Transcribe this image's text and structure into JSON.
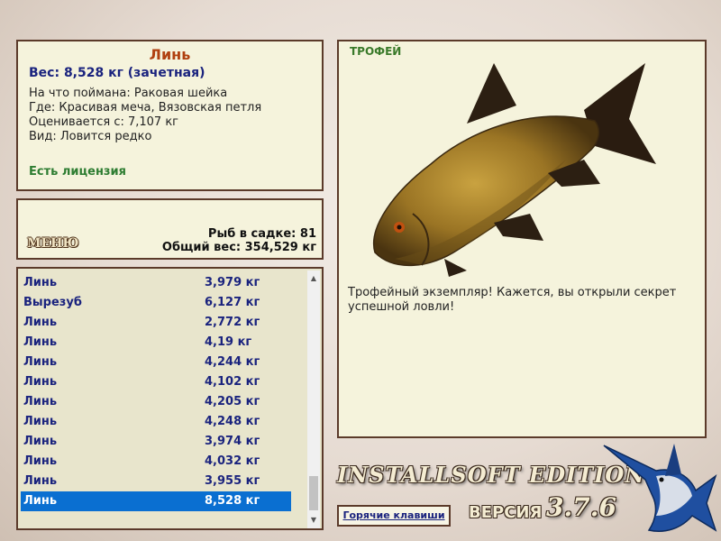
{
  "catch_info": {
    "fish_name": "Линь",
    "weight": "Вес: 8,528 кг (зачетная)",
    "bait": "На что поймана: Раковая шейка",
    "location": "Где: Красивая меча, Вязовская петля",
    "rated": "Оценивается с: 7,107 кг",
    "kind": "Вид: Ловится редко",
    "license": "Есть лицензия"
  },
  "cage": {
    "menu_label": "МЕНЮ",
    "fish_count": "Рыб в садке: 81",
    "total_weight": "Общий вес: 354,529 кг"
  },
  "fish_list": [
    {
      "name": "Линь",
      "weight": "3,979 кг"
    },
    {
      "name": "Вырезуб",
      "weight": "6,127 кг"
    },
    {
      "name": "Линь",
      "weight": "2,772 кг"
    },
    {
      "name": "Линь",
      "weight": "4,19 кг"
    },
    {
      "name": "Линь",
      "weight": "4,244 кг"
    },
    {
      "name": "Линь",
      "weight": "4,102 кг"
    },
    {
      "name": "Линь",
      "weight": "4,205 кг"
    },
    {
      "name": "Линь",
      "weight": "4,248 кг"
    },
    {
      "name": "Линь",
      "weight": "3,974 кг"
    },
    {
      "name": "Линь",
      "weight": "4,032 кг"
    },
    {
      "name": "Линь",
      "weight": "3,955 кг"
    },
    {
      "name": "Линь",
      "weight": "8,528 кг"
    }
  ],
  "trophy": {
    "label": "ТРОФЕЙ",
    "description": "Трофейный экземпляр! Кажется, вы открыли секрет успешной ловли!"
  },
  "footer": {
    "brand": "INSTALLSOFT EDITION",
    "version_label": "ВЕРСИЯ",
    "version": "3.7.6",
    "hotkeys": "Горячие клавиши"
  },
  "colors": {
    "panel_bg": "#f5f3dc",
    "panel_border": "#5b3a2a",
    "fish_name": "#b04010",
    "list_text": "#1a237e",
    "selection": "#0a6fd1",
    "license": "#2e7d32"
  }
}
